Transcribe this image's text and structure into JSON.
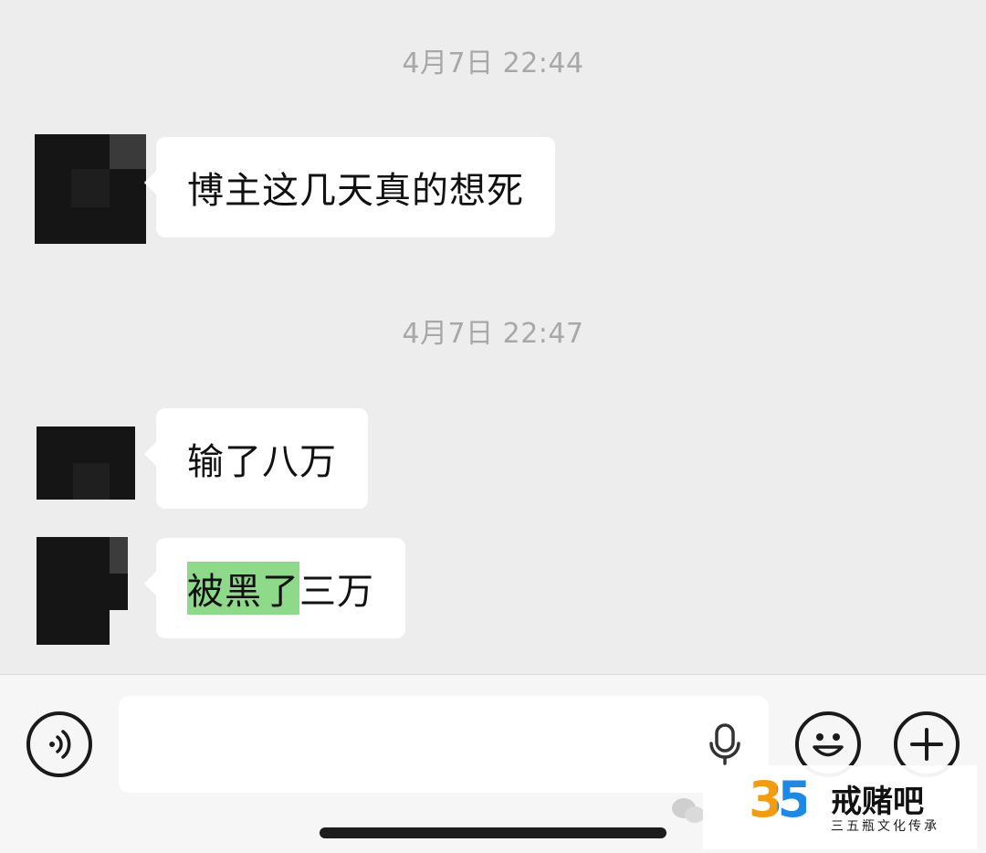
{
  "messages": [
    {
      "type": "timestamp",
      "text": "4月7日 22:44"
    },
    {
      "type": "incoming",
      "text": "博主这几天真的想死"
    },
    {
      "type": "timestamp",
      "text": "4月7日 22:47"
    },
    {
      "type": "incoming",
      "text": "输了八万"
    },
    {
      "type": "incoming",
      "highlighted": "被黑了",
      "text": "三万"
    }
  ],
  "input_bar": {
    "placeholder": "",
    "icons": [
      "voice-icon",
      "mic-icon",
      "emoji-icon",
      "plus-icon"
    ]
  },
  "watermark": {
    "number": "35",
    "title": "戒赌吧",
    "subtitle": "三五瓶文化传承"
  },
  "colors": {
    "background": "#ededed",
    "bubble": "#ffffff",
    "highlight": "#8fd98a",
    "timestamp": "#a8a8a8"
  }
}
